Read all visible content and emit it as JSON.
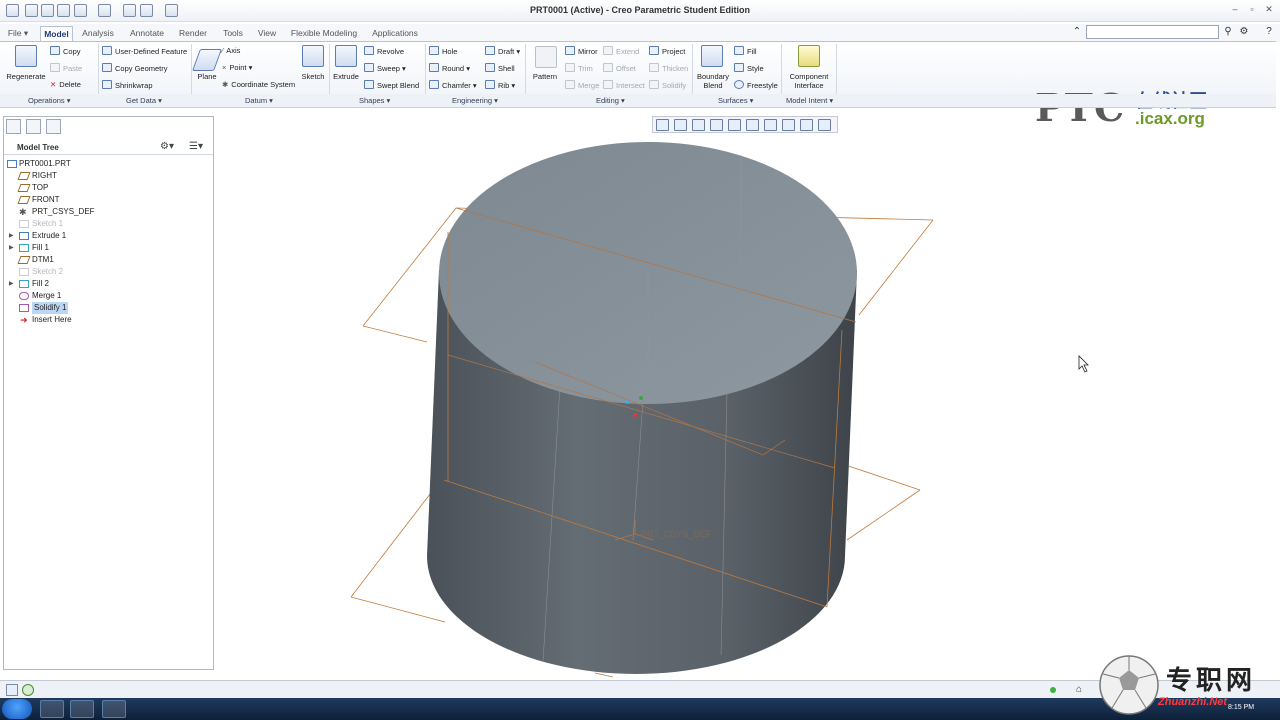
{
  "window": {
    "title": "PRT0001 (Active) - Creo Parametric Student Edition"
  },
  "tabs": [
    {
      "label": "File ▾"
    },
    {
      "label": "Model"
    },
    {
      "label": "Analysis"
    },
    {
      "label": "Annotate"
    },
    {
      "label": "Render"
    },
    {
      "label": "Tools"
    },
    {
      "label": "View"
    },
    {
      "label": "Flexible Modeling"
    },
    {
      "label": "Applications"
    }
  ],
  "ribbon": {
    "regenerate": "Regenerate",
    "copy": "Copy",
    "paste": "Paste",
    "delete": "Delete",
    "user_defined_feature": "User-Defined Feature",
    "copy_geometry": "Copy Geometry",
    "shrinkwrap": "Shrinkwrap",
    "plane": "Plane",
    "axis": "Axis",
    "point": "Point",
    "coordinate_system": "Coordinate System",
    "sketch": "Sketch",
    "extrude": "Extrude",
    "revolve": "Revolve",
    "sweep": "Sweep",
    "swept_blend": "Swept Blend",
    "hole": "Hole",
    "round": "Round",
    "chamfer": "Chamfer",
    "draft": "Draft",
    "shell": "Shell",
    "rib": "Rib",
    "pattern": "Pattern",
    "mirror": "Mirror",
    "trim": "Trim",
    "merge": "Merge",
    "extend": "Extend",
    "offset": "Offset",
    "intersect": "Intersect",
    "project": "Project",
    "thicken": "Thicken",
    "solidify": "Solidify",
    "boundary_blend_1": "Boundary",
    "boundary_blend_2": "Blend",
    "fill": "Fill",
    "style": "Style",
    "freestyle": "Freestyle",
    "component_interface_1": "Component",
    "component_interface_2": "Interface"
  },
  "groups": {
    "operations": "Operations ▾",
    "get_data": "Get Data ▾",
    "datum": "Datum ▾",
    "shapes": "Shapes ▾",
    "engineering": "Engineering ▾",
    "editing": "Editing ▾",
    "surfaces": "Surfaces ▾",
    "model_intent": "Model Intent ▾"
  },
  "logo": {
    "brand": "PTC",
    "cn": "在线社区",
    "site": ".icax.org"
  },
  "model_tree": {
    "title": "Model Tree",
    "items": [
      {
        "label": "PRT0001.PRT",
        "state": "normal"
      },
      {
        "label": "RIGHT",
        "state": "normal"
      },
      {
        "label": "TOP",
        "state": "normal"
      },
      {
        "label": "FRONT",
        "state": "normal"
      },
      {
        "label": "PRT_CSYS_DEF",
        "state": "normal"
      },
      {
        "label": "Sketch 1",
        "state": "dim"
      },
      {
        "label": "Extrude 1",
        "state": "normal"
      },
      {
        "label": "Fill 1",
        "state": "normal"
      },
      {
        "label": "DTM1",
        "state": "normal"
      },
      {
        "label": "Sketch 2",
        "state": "dim"
      },
      {
        "label": "Fill 2",
        "state": "normal"
      },
      {
        "label": "Merge 1",
        "state": "normal"
      },
      {
        "label": "Solidify 1",
        "state": "selected"
      },
      {
        "label": "Insert Here",
        "state": "normal"
      }
    ]
  },
  "graphics": {
    "csys_label": "PRT_CSYS_DEF",
    "body_color": "#5d656d",
    "top_color": "#848e97",
    "datum_color": "#c07a3a"
  },
  "taskbar": {
    "clock": "8:15 PM"
  },
  "watermark": {
    "cn": "专职网",
    "url": "Zhuanzhi.Net"
  }
}
